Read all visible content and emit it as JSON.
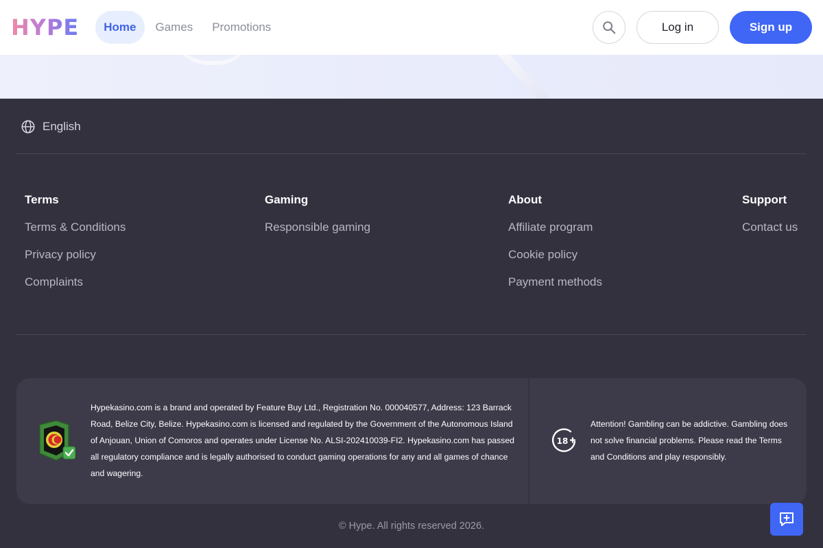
{
  "header": {
    "logo": "HYPE",
    "nav": [
      {
        "label": "Home",
        "active": true
      },
      {
        "label": "Games",
        "active": false
      },
      {
        "label": "Promotions",
        "active": false
      }
    ],
    "search_icon": "search-icon",
    "login_label": "Log in",
    "signup_label": "Sign up"
  },
  "footer": {
    "language": "English",
    "columns": [
      {
        "title": "Terms",
        "links": [
          "Terms & Conditions",
          "Privacy policy",
          "Complaints"
        ]
      },
      {
        "title": "Gaming",
        "links": [
          "Responsible gaming"
        ]
      },
      {
        "title": "About",
        "links": [
          "Affiliate program",
          "Cookie policy",
          "Payment methods"
        ]
      },
      {
        "title": "Support",
        "links": [
          "Contact us"
        ]
      }
    ],
    "license_text": "Hypekasino.com is a brand and operated by Feature Buy Ltd., Registration No. 000040577, Address: 123 Barrack Road, Belize City, Belize. Hypekasino.com is licensed and regulated by the Government of the Autonomous Island of Anjouan, Union of Comoros and operates under License No. ALSI-202410039-FI2. Hypekasino.com has passed all regulatory compliance and is legally authorised to conduct gaming operations for any and all games of chance and wagering.",
    "age_label": "18+",
    "warning_text": "Attention! Gambling can be addictive. Gambling does not solve financial problems. Please read the Terms and Conditions and play responsibly.",
    "copyright": "© Hype. All rights reserved 2026."
  },
  "colors": {
    "accent": "#4066f6",
    "footer_bg": "#34313f",
    "license_bg": "#3d3a49"
  }
}
